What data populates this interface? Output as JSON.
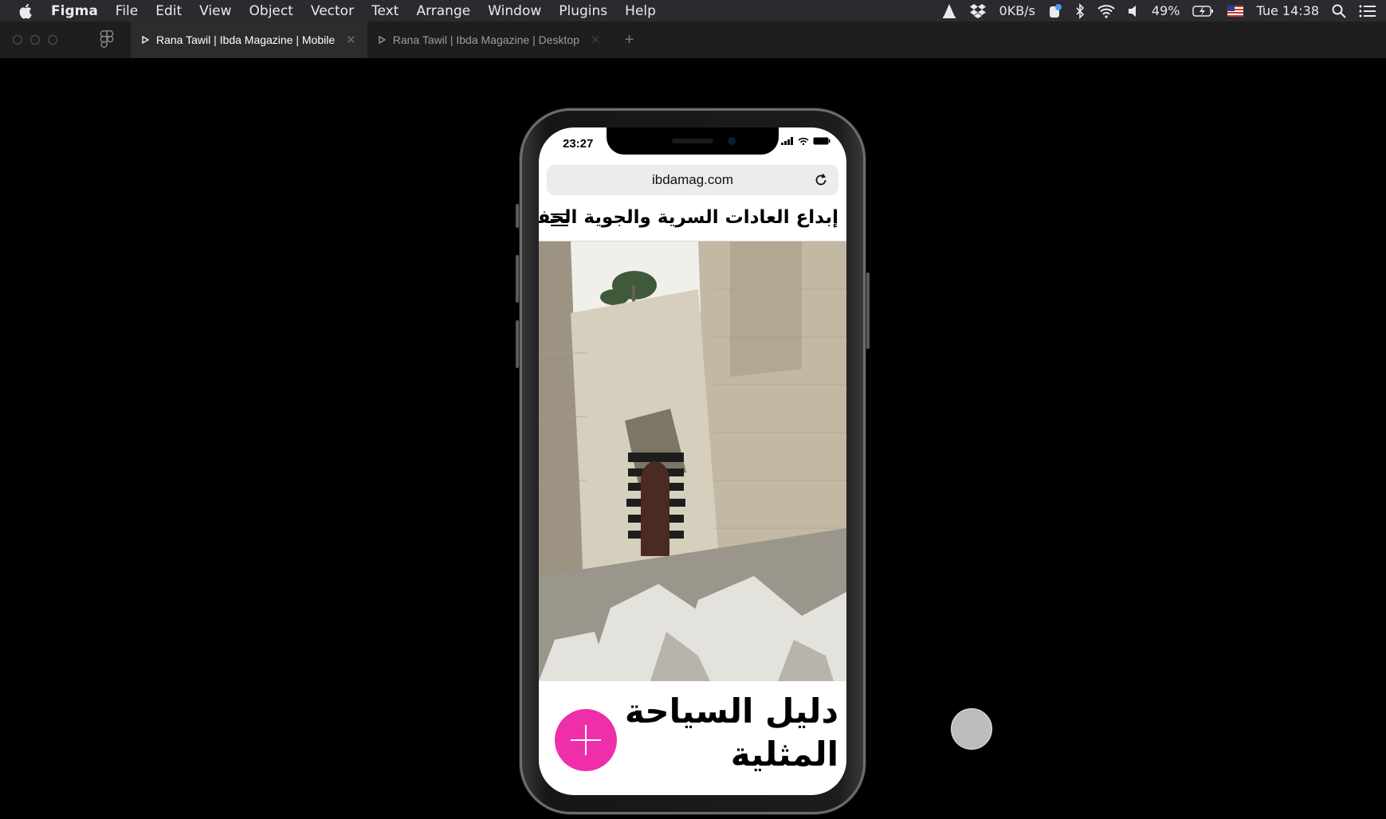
{
  "menubar": {
    "app_name": "Figma",
    "items": [
      "File",
      "Edit",
      "View",
      "Object",
      "Vector",
      "Text",
      "Arrange",
      "Window",
      "Plugins",
      "Help"
    ],
    "net_speed": "0KB/s",
    "battery": "49%",
    "clock": "Tue 14:38"
  },
  "tabs": [
    {
      "label": "Rana Tawil | Ibda Magazine | Mobile",
      "active": true
    },
    {
      "label": "Rana Tawil | Ibda Magazine | Desktop",
      "active": false
    }
  ],
  "phone": {
    "time": "23:27",
    "url": "ibdamag.com",
    "headline": "إبداع العادات السرية والجوية الخفية",
    "caption": "دليل السياحة المثلية",
    "fab_color": "#ee2fa9"
  }
}
